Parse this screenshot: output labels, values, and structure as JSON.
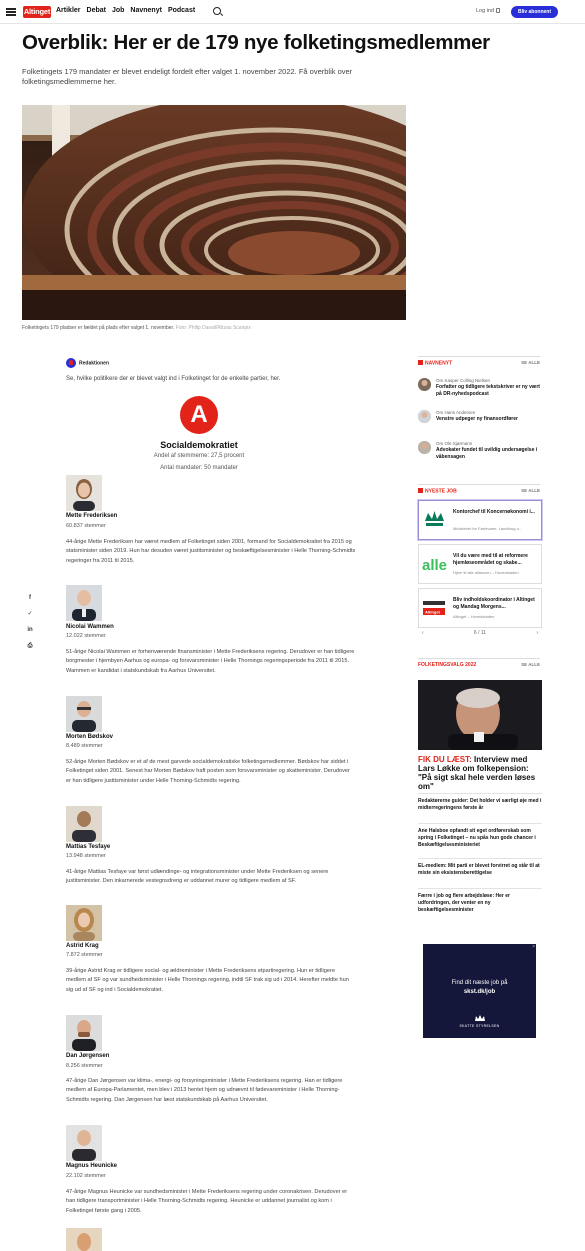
{
  "header": {
    "logo": "Altinget",
    "nav": [
      "Artikler",
      "Debat",
      "Job",
      "Navnenyt",
      "Podcast"
    ],
    "login": "Log ind",
    "subscribe": "Bliv abonnent"
  },
  "article": {
    "title": "Overblik: Her er de 179 nye folketingsmedlemmer",
    "lead": "Folketingets 179 mandater er blevet endeligt fordelt efter valget 1. november 2022. Få overblik over folketingsmedlemmerne her.",
    "caption": "Folketingets 179 pladser er fældet på plads efter valget 1. november.",
    "credit": "Foto: Philip Davali/Ritzau Scanpix",
    "author": "Redaktionen",
    "intro": "Se, hvilke politikere der er blevet valgt ind i Folketinget for de enkelte partier, her."
  },
  "party": {
    "letter": "A",
    "name": "Socialdemokratiet",
    "share": "Andel af stemmerne: 27,5 procent",
    "seats": "Antal mandater: 50 mandater"
  },
  "members": [
    {
      "name": "Mette Frederiksen",
      "votes": "60.837 stemmer",
      "bio": "44-årige Mette Frederiksen har været medlem af Folketinget siden 2001, formand for Socialdemokratiet fra 2015 og statsminister siden 2019. Hun har desuden været justitsminister og beskæftigelsesminister i Helle Thorning-Schmidts regeringer fra 2011 til 2015."
    },
    {
      "name": "Nicolai Wammen",
      "votes": "12.022 stemmer",
      "bio": "51-årige Nicolai Wammen er forhenværende finansminister i Mette Frederiksens regering. Derudover er han tidligere borgmester i hjembyen Aarhus og europa- og forsvarsminister i Helle Thornings regeringsperiode fra 2011 til 2015. Wammen er kandidat i statskundskab fra Aarhus Universitet."
    },
    {
      "name": "Morten Bødskov",
      "votes": "8.489 stemmer",
      "bio": "52-årige Morten Bødskov er et af de mest garvede socialdemokratiske folketingsmedlemmer. Bødskov har siddet i Folketinget siden 2001. Senest har Morten Bødskov haft posten som forsvarsminister og skatteminister. Derudover er han tidligere justitsminister under Helle Thorning-Schmidts regering."
    },
    {
      "name": "Mattias Tesfaye",
      "votes": "13.948 stemmer",
      "bio": "41-årige Mattias Tesfaye var først udlændinge- og integrationsminister under Mette Frederiksen og senere justitsminister. Den inkarnerede vestegnsdreng er uddannet murer og tidligere medlem af SF."
    },
    {
      "name": "Astrid Krag",
      "votes": "7.872 stemmer",
      "bio": "39-årige Astrid Krag er tidligere social- og ældreminister i Mette Frederiksens etpartiregering. Hun er tidligere medlem af SF og var sundhedsminister i Helle Thornings regering, indtil SF trak sig ud i 2014. Herefter meldte hun sig ud af SF og ind i Socialdemokratiet."
    },
    {
      "name": "Dan Jørgensen",
      "votes": "8.256 stemmer",
      "bio": "47-årige Dan Jørgensen var klima-, energi- og forsyningsminister i Mette Frederiksens regering. Han er tidligere medlem af Europa-Parlamentet, men blev i 2013 hentet hjem og udnævnt til fødevareminister i Helle Thorning-Schmidts regering. Dan Jørgensen har læst statskundskab på Aarhus Universitet."
    },
    {
      "name": "Magnus Heunicke",
      "votes": "22.102 stemmer",
      "bio": "47-årige Magnus Heunicke var sundhedsminister i Mette Frederiksens regering under coronakrisen. Derudover er han tidligere transportminister i Helle Thorning-Schmidts regering. Heunicke er uddannet journalist og kom i Folketinget første gang i 2005."
    }
  ],
  "sidebar": {
    "navnenyt": {
      "title": "NAVNENYT",
      "see_all": "SE ALLE",
      "items": [
        {
          "who": "Om Kasper Colling Nielsen",
          "what": "Forfatter og tidligere tekstskriver er ny vært på DR-nyhedspodcast"
        },
        {
          "who": "Om Hans Andersen",
          "what": "Venstre udpeger ny finansordfører"
        },
        {
          "who": "Om Ole Sjørmann",
          "what": "Advokater fundet til uvildig undersøgelse i våbensagen"
        }
      ]
    },
    "jobs": {
      "title": "NYESTE JOB",
      "see_all": "SE ALLE",
      "items": [
        {
          "title": "Kontorchef til Koncernøkonomi i...",
          "sub": "Ministeriet for Fødevarer, Landbrug o..."
        },
        {
          "title": "Vil du være med til at reformere hjemløseområdet og skabe...",
          "sub": "Hjem til alle alliancen – Hovedstaden"
        },
        {
          "title": "Bliv indholdskoordinator i Altinget og Mandag Morgens...",
          "sub": "Altinget – Hovedstaden"
        }
      ],
      "pager": "6 / 11"
    },
    "valg": {
      "title": "FOLKETINGSVALG 2022",
      "see_all": "SE ALLE",
      "top_red": "FIK DU LÆST:",
      "top_black": " Interview med Lars Løkke om folkepension: \"På sigt skal hele verden løses om\"",
      "items": [
        "Redaktørerne guider: Det holder vi særligt øje med i midterregeringens første år",
        "Ane Halsboe opfandt sit eget ordførerskab som spring i Folketinget – nu spås hun gode chancer i Beskæftigelsesministeriet",
        "EL-medlem: Mit parti er blevet forvirret og står til at miste sin eksistensberettigelse",
        "Færre i job og flere arbejdsløse: Her er udfordringen, der venter en ny beskæftigelsesminister"
      ]
    },
    "ad": {
      "line1": "Find dit næste job på",
      "line2": "skst.dk/job",
      "brand": "SKATTE STYRELSEN"
    },
    "alle_logo": "alle",
    "altinget_small": "Altinget"
  },
  "share_icons": [
    "facebook-icon",
    "twitter-icon",
    "linkedin-icon",
    "print-icon"
  ]
}
